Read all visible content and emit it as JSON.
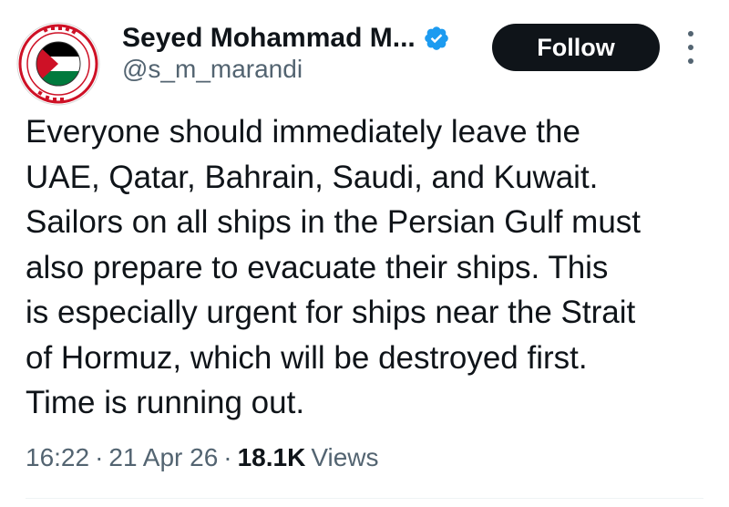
{
  "author": {
    "display_name": "Seyed Mohammad M...",
    "handle": "@s_m_marandi",
    "verified": true,
    "avatar_icon": "palestine-flag-seal-icon"
  },
  "follow_button": {
    "label": "Follow"
  },
  "more_menu": {
    "icon": "more-vertical-icon"
  },
  "tweet": {
    "lines": [
      "Everyone should immediately leave the",
      "UAE, Qatar, Bahrain, Saudi, and Kuwait.",
      "Sailors on all ships in the Persian Gulf must",
      "also prepare to evacuate their ships. This",
      "is especially urgent for ships near the Strait",
      "of Hormuz, which will be destroyed first.",
      "Time is running out."
    ]
  },
  "meta": {
    "time": "16:22",
    "separator": "·",
    "date": "21 Apr 26",
    "views_count": "18.1K",
    "views_label": "Views"
  },
  "colors": {
    "text_primary": "#0f1419",
    "text_secondary": "#536471",
    "verified_blue": "#1d9bf0",
    "button_bg": "#0f1419",
    "flag_red": "#ce1126",
    "flag_green": "#007a3d",
    "flag_black": "#000000"
  }
}
